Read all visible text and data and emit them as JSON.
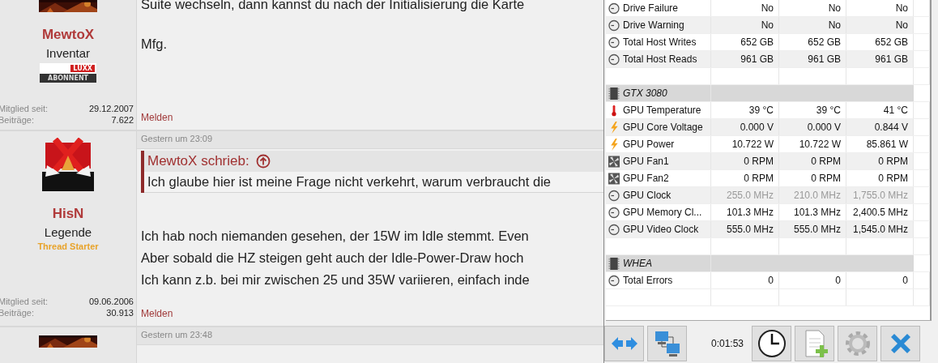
{
  "forum": {
    "posts": [
      {
        "author": "MewtoX",
        "rank": "Inventar",
        "badge": {
          "top": "LUXX",
          "bottom": "ABONNENT"
        },
        "member_since_label": "Mitglied seit:",
        "member_since": "29.12.2007",
        "posts_label": "Beiträge:",
        "posts": "7.622",
        "body": [
          "Suite wechseln, dann kannst du nach der Initialisierung die Karte",
          "Mfg."
        ],
        "report": "Melden"
      },
      {
        "date": "Gestern um 23:09",
        "author": "HisN",
        "rank": "Legende",
        "thread_starter": "Thread Starter",
        "member_since_label": "Mitglied seit:",
        "member_since": "09.06.2006",
        "posts_label": "Beiträge:",
        "posts": "30.913",
        "quote": {
          "author": "MewtoX schrieb:",
          "text": "Ich glaube hier ist meine Frage nicht verkehrt, warum verbraucht die"
        },
        "body": [
          "Ich hab noch niemanden gesehen, der 15W im Idle stemmt. Even",
          "Aber sobald die HZ steigen geht auch der Idle-Power-Draw hoch",
          "Ich kann z.b. bei mir zwischen 25 und 35W variieren, einfach inde"
        ],
        "report": "Melden"
      },
      {
        "date": "Gestern um 23:48"
      }
    ]
  },
  "sensors": {
    "rows": [
      {
        "kind": "clock",
        "label": "Drive Failure",
        "values": [
          "No",
          "No",
          "No"
        ],
        "dimmed": false
      },
      {
        "kind": "clock",
        "label": "Drive Warning",
        "values": [
          "No",
          "No",
          "No"
        ],
        "dimmed": false
      },
      {
        "kind": "clock",
        "label": "Total Host Writes",
        "values": [
          "652 GB",
          "652 GB",
          "652 GB"
        ],
        "dimmed": false
      },
      {
        "kind": "clock",
        "label": "Total Host Reads",
        "values": [
          "961 GB",
          "961 GB",
          "961 GB"
        ],
        "dimmed": false
      },
      {
        "kind": "blank"
      },
      {
        "kind": "group",
        "label": "GTX 3080"
      },
      {
        "kind": "temperature",
        "label": "GPU Temperature",
        "values": [
          "39 °C",
          "39 °C",
          "41 °C"
        ],
        "dimmed": false
      },
      {
        "kind": "power",
        "label": "GPU Core Voltage",
        "values": [
          "0.000 V",
          "0.000 V",
          "0.844 V"
        ],
        "dimmed": false
      },
      {
        "kind": "power",
        "label": "GPU Power",
        "values": [
          "10.722 W",
          "10.722 W",
          "85.861 W"
        ],
        "dimmed": false
      },
      {
        "kind": "fan",
        "label": "GPU Fan1",
        "values": [
          "0 RPM",
          "0 RPM",
          "0 RPM"
        ],
        "dimmed": false
      },
      {
        "kind": "fan",
        "label": "GPU Fan2",
        "values": [
          "0 RPM",
          "0 RPM",
          "0 RPM"
        ],
        "dimmed": false
      },
      {
        "kind": "clock",
        "label": "GPU Clock",
        "values": [
          "255.0 MHz",
          "210.0 MHz",
          "1,755.0 MHz"
        ],
        "dimmed": true
      },
      {
        "kind": "clock",
        "label": "GPU Memory Cl...",
        "values": [
          "101.3 MHz",
          "101.3 MHz",
          "2,400.5 MHz"
        ],
        "dimmed": false
      },
      {
        "kind": "clock",
        "label": "GPU Video Clock",
        "values": [
          "555.0 MHz",
          "555.0 MHz",
          "1,545.0 MHz"
        ],
        "dimmed": false
      },
      {
        "kind": "blank"
      },
      {
        "kind": "group",
        "label": "WHEA"
      },
      {
        "kind": "clock",
        "label": "Total Errors",
        "values": [
          "0",
          "0",
          "0"
        ],
        "dimmed": false
      },
      {
        "kind": "blank"
      }
    ],
    "timer": "0:01:53"
  }
}
